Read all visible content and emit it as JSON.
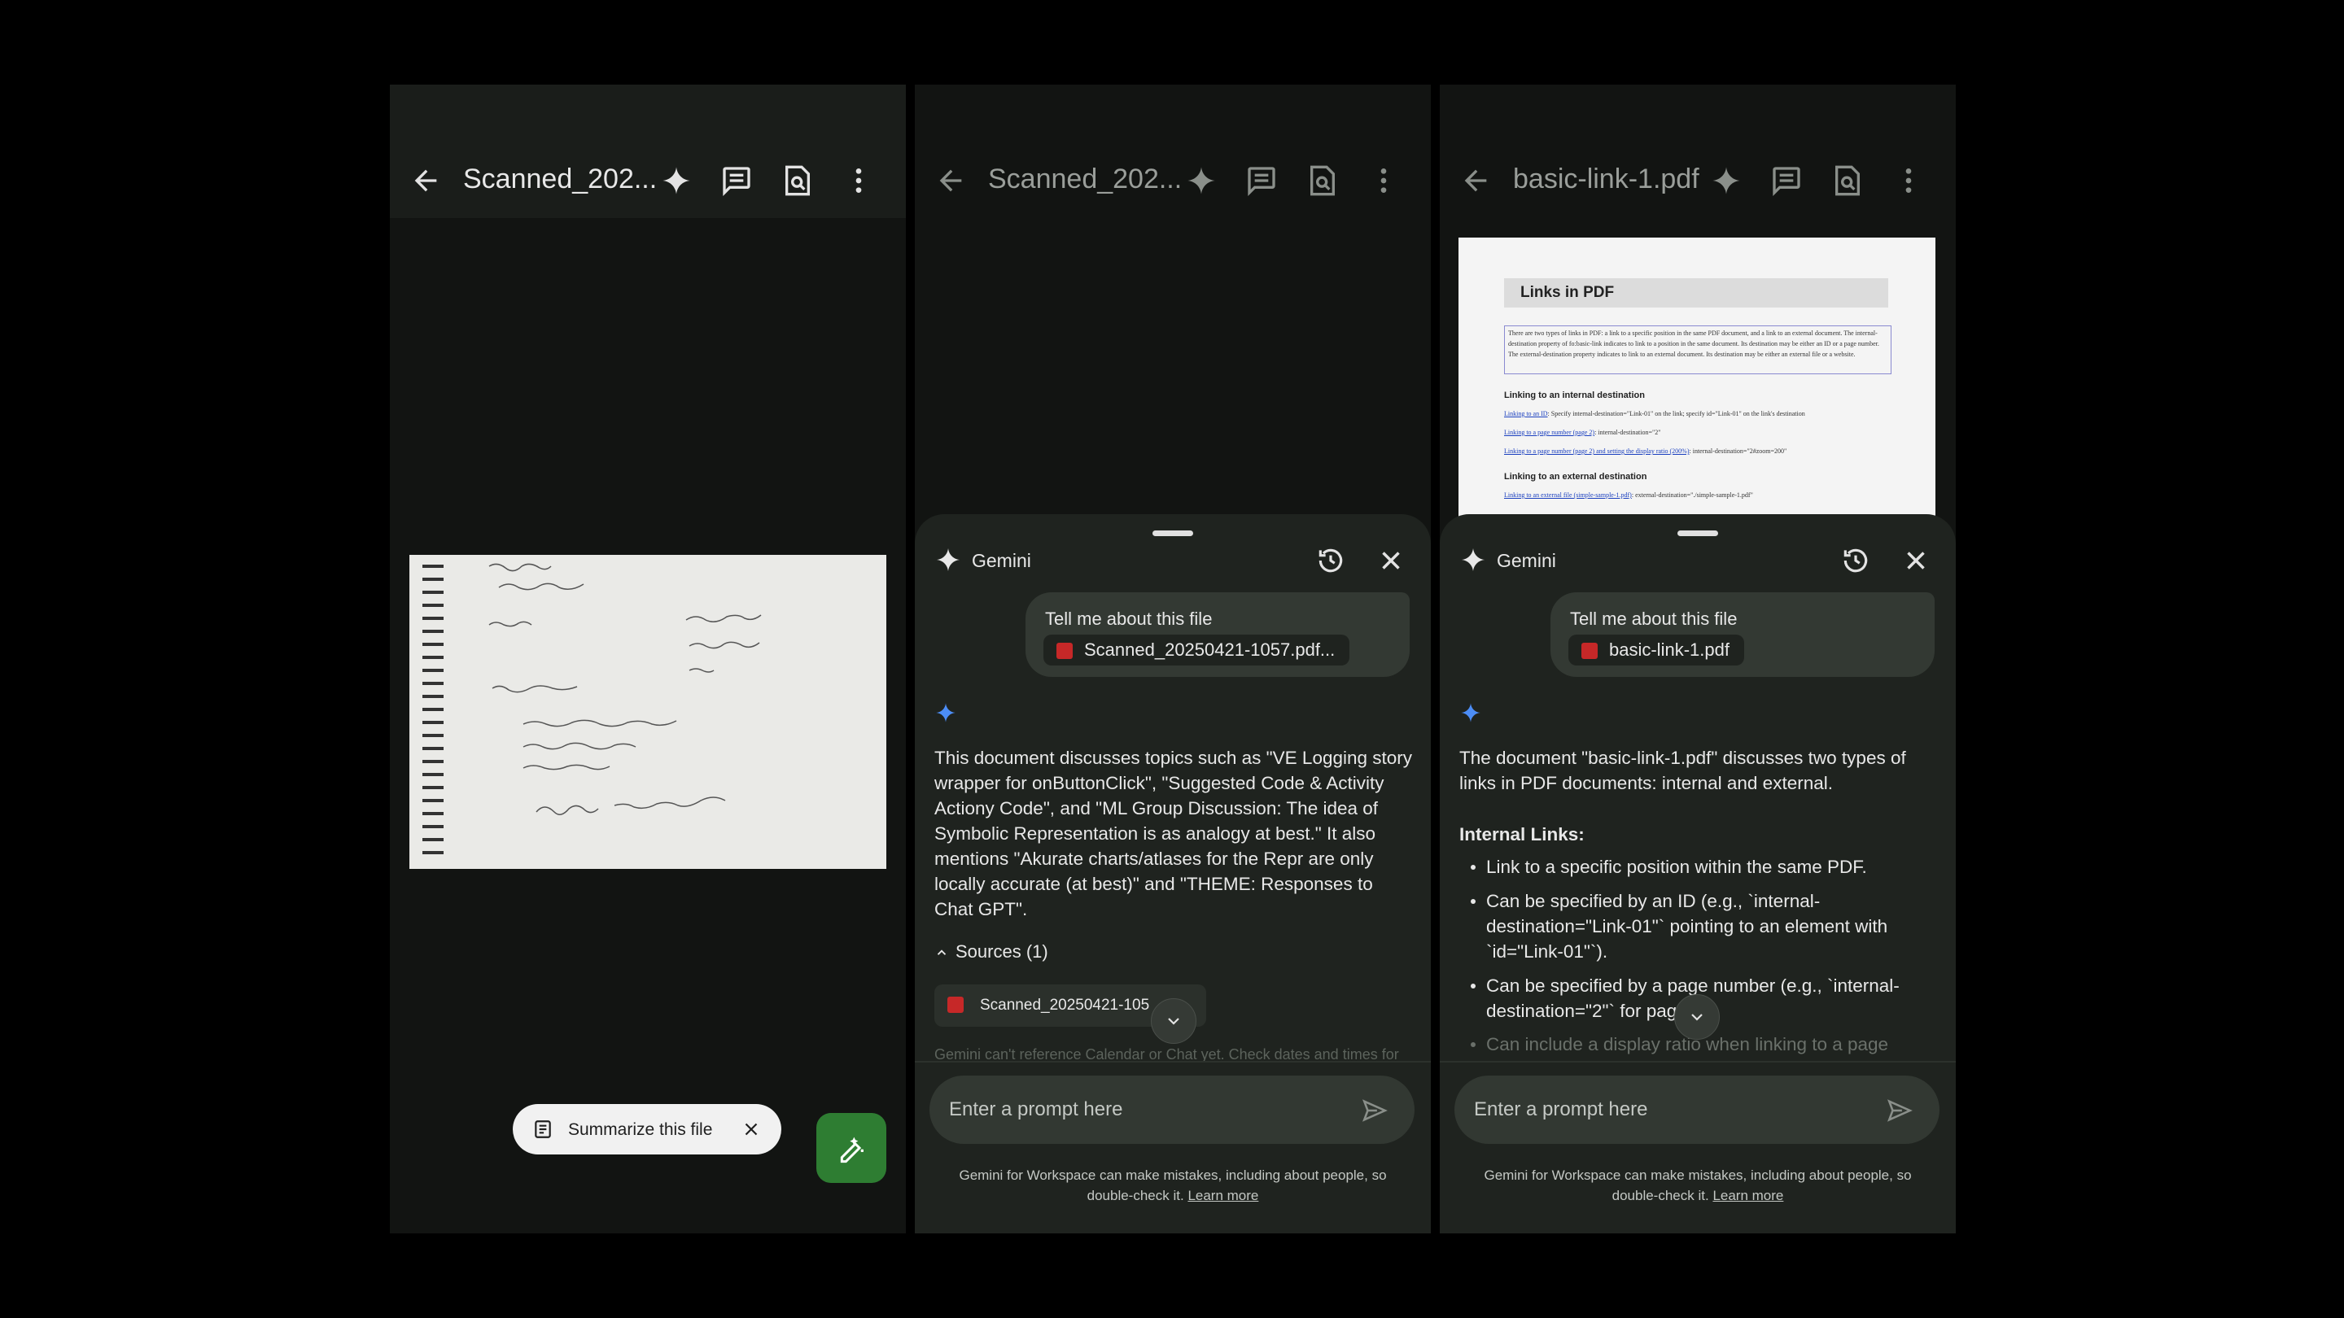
{
  "panels": [
    {
      "title": "Scanned_202...",
      "icons": [
        "arrow-back-icon",
        "sparkle-icon",
        "comment-icon",
        "search-document-icon",
        "more-vert-icon"
      ],
      "summarize_chip": "Summarize this file"
    },
    {
      "title": "Scanned_202...",
      "gemini": {
        "label": "Gemini",
        "prompt_text": "Tell me about this file",
        "file_name": "Scanned_20250421-1057.pdf...",
        "response": "This document discusses topics such as \"VE Logging story wrapper for onButtonClick\", \"Suggested Code & Activity Actiony Code\", and \"ML Group Discussion: The idea of Symbolic Representation is as analogy at best.\" It also mentions \"Akurate charts/atlases for the Repr are only locally accurate (at best)\" and \"THEME: Responses to Chat GPT\".",
        "sources_label": "Sources (1)",
        "source_file": "Scanned_20250421-105",
        "faded_note": "Gemini can't reference Calendar or Chat yet. Check dates and times for",
        "input_placeholder": "Enter a prompt here",
        "disclaimer_line1": "Gemini for Workspace can make mistakes, including about people, so",
        "disclaimer_line2": "double-check it.",
        "learn_more": "Learn more"
      }
    },
    {
      "title": "basic-link-1.pdf",
      "pdf_preview": {
        "heading": "Links in PDF",
        "intro": "There are two types of links in PDF: a link to a specific position in the same PDF document, and a link to an external document. The internal-destination property of fo:basic-link indicates to link to a position in the same document. Its destination may be either an ID or a page number. The external-destination property indicates to link to an external document. Its destination may be either an external file or a website.",
        "sub1": "Linking to an internal destination",
        "links1": [
          {
            "link": "Linking to an ID",
            "desc": ": Specify internal-destination=\"Link-01\" on the link; specify id=\"Link-01\" on the link's destination"
          },
          {
            "link": "Linking to a page number (page 2)",
            "desc": ": internal-destination=\"2\""
          },
          {
            "link": "Linking to a page number (page 2) and setting the display ratio (200%)",
            "desc": ": internal-destination=\"2#zoom=200\""
          }
        ],
        "sub2": "Linking to an external destination",
        "links2": [
          {
            "link": "Linking to an external file (simple-sample-1.pdf)",
            "desc": ": external-destination=\"./simple-sample-1.pdf\""
          }
        ]
      },
      "gemini": {
        "label": "Gemini",
        "prompt_text": "Tell me about this file",
        "file_name": "basic-link-1.pdf",
        "response_intro": "The document \"basic-link-1.pdf\" discusses two types of links in PDF documents: internal and external.",
        "section_title": "Internal Links:",
        "bullets": [
          "Link to a specific position within the same PDF.",
          "Can be specified by an ID (e.g., `internal-destination=\"Link-01\"` pointing to an element with `id=\"Link-01\"`).",
          "Can be specified by a page number (e.g., `internal-destination=\"2\"` for page 2).",
          "Can include a display ratio when linking to a page"
        ],
        "input_placeholder": "Enter a prompt here",
        "disclaimer_line1": "Gemini for Workspace can make mistakes, including about people, so",
        "disclaimer_line2": "double-check it.",
        "learn_more": "Learn more"
      }
    }
  ],
  "colors": {
    "accent_fab": "#2e7d32",
    "gemini_blue": "#4c8df6",
    "pdf_red": "#c62828"
  }
}
